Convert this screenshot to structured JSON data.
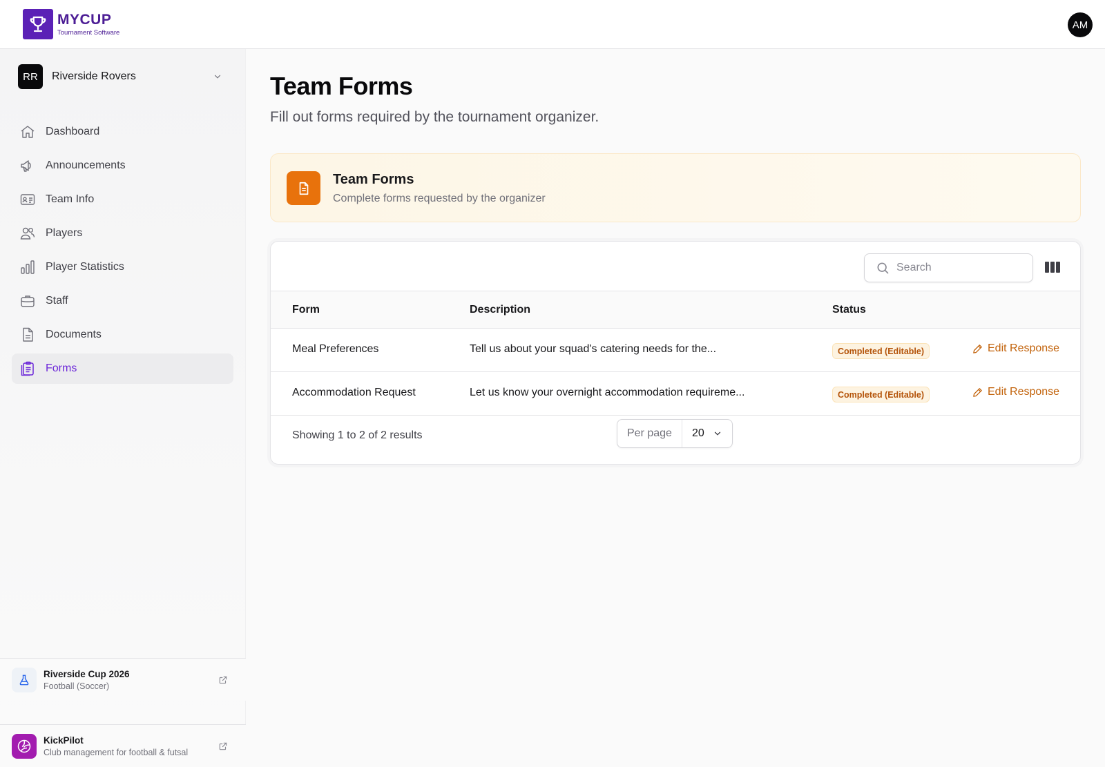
{
  "brand": {
    "name": "MYCUP",
    "tagline": "Tournament Software"
  },
  "user": {
    "initials": "AM"
  },
  "team": {
    "initials": "RR",
    "name": "Riverside Rovers"
  },
  "nav": [
    {
      "label": "Dashboard",
      "icon": "home-icon"
    },
    {
      "label": "Announcements",
      "icon": "megaphone-icon"
    },
    {
      "label": "Team Info",
      "icon": "id-card-icon"
    },
    {
      "label": "Players",
      "icon": "users-icon"
    },
    {
      "label": "Player Statistics",
      "icon": "bar-chart-icon"
    },
    {
      "label": "Staff",
      "icon": "briefcase-icon"
    },
    {
      "label": "Documents",
      "icon": "document-icon"
    },
    {
      "label": "Forms",
      "icon": "clipboard-icon",
      "active": true
    }
  ],
  "tournament": {
    "name": "Riverside Cup 2026",
    "sport": "Football (Soccer)"
  },
  "promo": {
    "name": "KickPilot",
    "tagline": "Club management for football & futsal"
  },
  "page": {
    "title": "Team Forms",
    "subtitle": "Fill out forms required by the tournament organizer."
  },
  "banner": {
    "title": "Team Forms",
    "subtitle": "Complete forms requested by the organizer"
  },
  "table": {
    "search_placeholder": "Search",
    "columns": {
      "form": "Form",
      "description": "Description",
      "status": "Status"
    },
    "rows": [
      {
        "form": "Meal Preferences",
        "description": "Tell us about your squad's catering needs for the...",
        "status": "Completed (Editable)",
        "action": "Edit Response"
      },
      {
        "form": "Accommodation Request",
        "description": "Let us know your overnight accommodation requireme...",
        "status": "Completed (Editable)",
        "action": "Edit Response"
      }
    ],
    "summary": "Showing 1 to 2 of 2 results",
    "per_page_label": "Per page",
    "per_page_value": "20"
  },
  "colors": {
    "brand": "#5b21b6",
    "accent": "#e8720c",
    "active_nav": "#6d28d9",
    "badge_text": "#b45309"
  }
}
